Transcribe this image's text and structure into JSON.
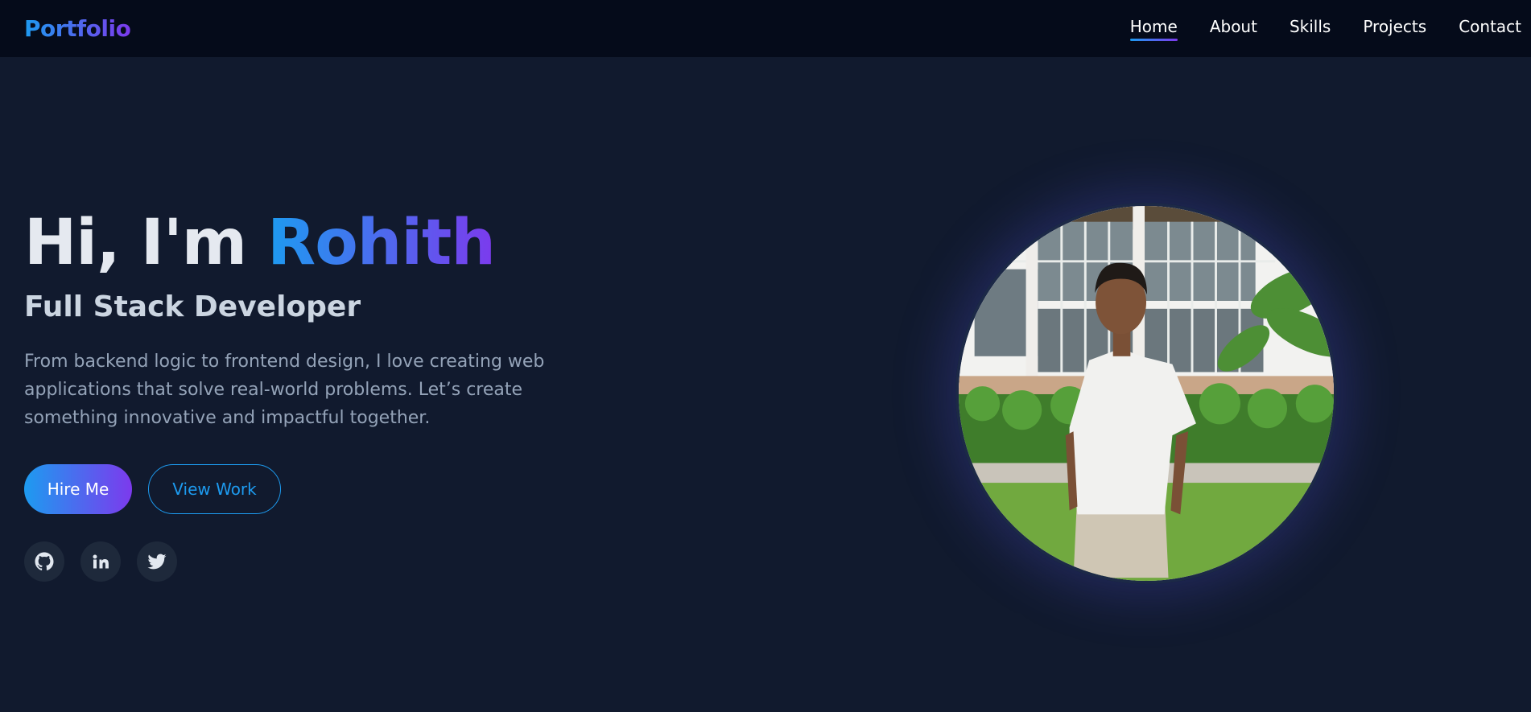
{
  "nav": {
    "logo": "Portfolio",
    "links": [
      "Home",
      "About",
      "Skills",
      "Projects",
      "Contact"
    ],
    "active": "Home"
  },
  "hero": {
    "greeting": "Hi, I'm",
    "name": "Rohith",
    "subtitle": "Full Stack Developer",
    "description": "From backend logic to frontend design, I love creating web applications that solve real-world problems. Let’s create something innovative and impactful together.",
    "primary_button": "Hire Me",
    "secondary_button": "View Work"
  },
  "social": [
    "github-icon",
    "linkedin-icon",
    "twitter-icon"
  ],
  "colors": {
    "background": "#111a2e",
    "navbar": "#050b1a",
    "accent_start": "#1d9bf0",
    "accent_end": "#7c3aed",
    "social_bg": "#1e293b"
  }
}
